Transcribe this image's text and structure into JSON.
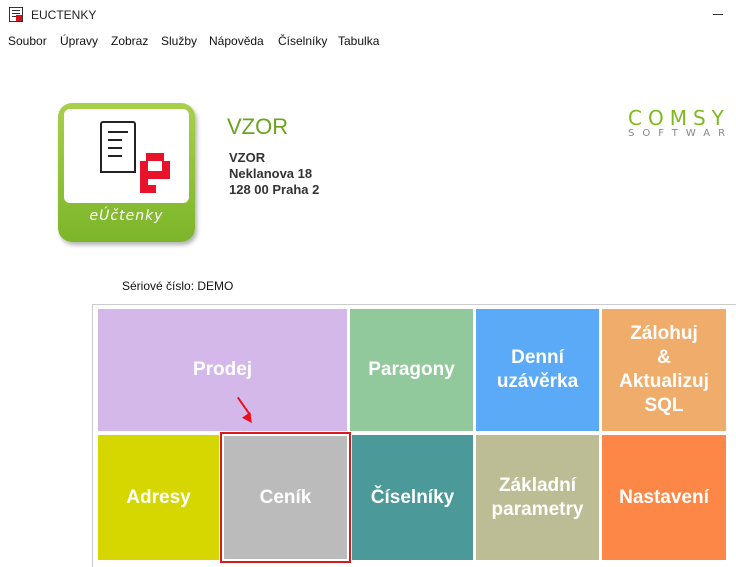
{
  "window": {
    "title": "EUCTENKY"
  },
  "menu": [
    "Soubor",
    "Úpravy",
    "Zobraz",
    "Služby",
    "Nápověda",
    "Číselníky",
    "Tabulka"
  ],
  "logo": {
    "label": "eÚčtenky"
  },
  "company": {
    "heading": "VZOR",
    "address": [
      "VZOR",
      "Neklanova 18",
      "128 00 Praha 2"
    ]
  },
  "brand": {
    "name": "COMSY",
    "sub": "SOFTWAR"
  },
  "serial": "Sériové číslo: DEMO",
  "tiles": {
    "prodej": {
      "lines": [
        "Prodej"
      ],
      "color": "#d4b8ea"
    },
    "paragony": {
      "lines": [
        "Paragony"
      ],
      "color": "#91c89c"
    },
    "uzaverka": {
      "lines": [
        "Denní",
        "uzávěrka"
      ],
      "color": "#5aaaf7"
    },
    "zalohuj": {
      "lines": [
        "Zálohuj",
        "&",
        "Aktualizuj",
        "SQL"
      ],
      "color": "#f0ac6a"
    },
    "adresy": {
      "lines": [
        "Adresy"
      ],
      "color": "#d6d600"
    },
    "cenik": {
      "lines": [
        "Ceník"
      ],
      "color": "#bbbbbb"
    },
    "ciselniky": {
      "lines": [
        "Číselníky"
      ],
      "color": "#4b9a99"
    },
    "zakladni": {
      "lines": [
        "Základní",
        "parametry"
      ],
      "color": "#bcbc95"
    },
    "nastaveni": {
      "lines": [
        "Nastavení"
      ],
      "color": "#fd8746"
    }
  }
}
